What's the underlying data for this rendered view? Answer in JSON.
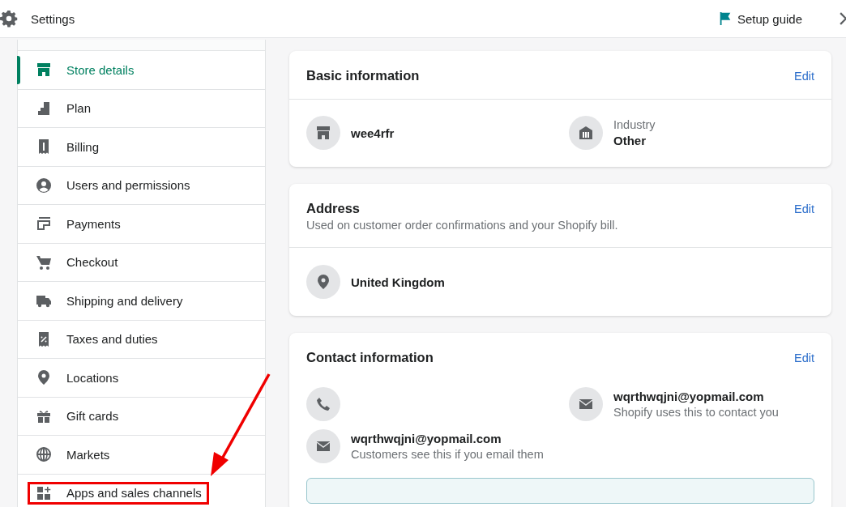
{
  "top_bar": {
    "title": "Settings",
    "setup_guide": "Setup guide"
  },
  "sidebar": {
    "items": [
      {
        "label": "Store details",
        "selected": true,
        "highlighted": false
      },
      {
        "label": "Plan",
        "selected": false,
        "highlighted": false
      },
      {
        "label": "Billing",
        "selected": false,
        "highlighted": false
      },
      {
        "label": "Users and permissions",
        "selected": false,
        "highlighted": false
      },
      {
        "label": "Payments",
        "selected": false,
        "highlighted": false
      },
      {
        "label": "Checkout",
        "selected": false,
        "highlighted": false
      },
      {
        "label": "Shipping and delivery",
        "selected": false,
        "highlighted": false
      },
      {
        "label": "Taxes and duties",
        "selected": false,
        "highlighted": false
      },
      {
        "label": "Locations",
        "selected": false,
        "highlighted": false
      },
      {
        "label": "Gift cards",
        "selected": false,
        "highlighted": false
      },
      {
        "label": "Markets",
        "selected": false,
        "highlighted": false
      },
      {
        "label": "Apps and sales channels",
        "selected": false,
        "highlighted": true
      }
    ]
  },
  "basic_information": {
    "title": "Basic information",
    "edit": "Edit",
    "store_name": "wee4rfr",
    "industry_label": "Industry",
    "industry_value": "Other"
  },
  "address": {
    "title": "Address",
    "edit": "Edit",
    "subtitle": "Used on customer order confirmations and your Shopify bill.",
    "country": "United Kingdom"
  },
  "contact_information": {
    "title": "Contact information",
    "edit": "Edit",
    "entries": [
      {
        "kind": "phone"
      },
      {
        "kind": "email",
        "value": "wqrthwqjni@yopmail.com",
        "note": "Shopify uses this to contact you"
      },
      {
        "kind": "email",
        "value": "wqrthwqjni@yopmail.com",
        "note": "Customers see this if you email them"
      }
    ]
  }
}
